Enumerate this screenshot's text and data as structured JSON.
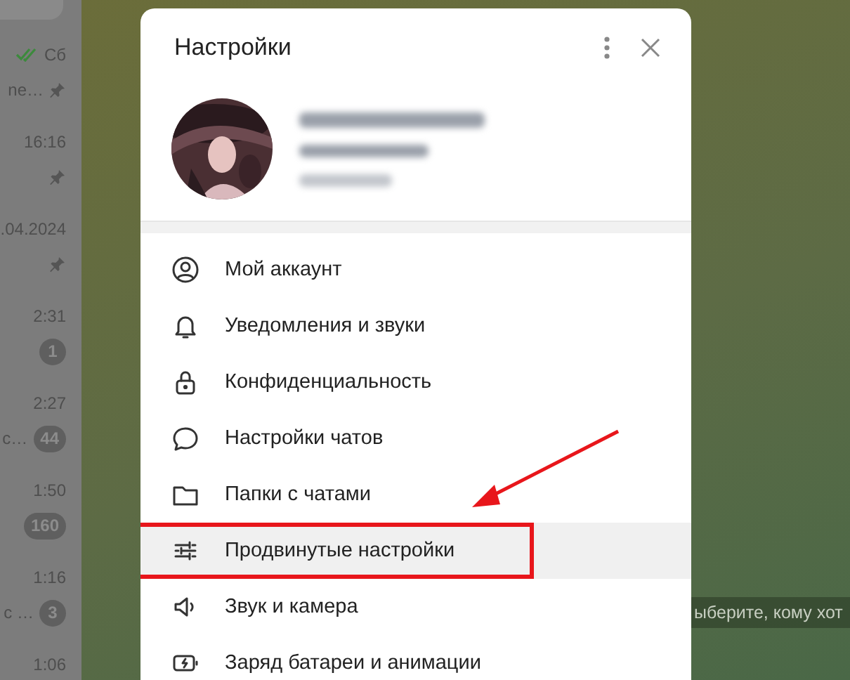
{
  "chat_list": [
    {
      "time": "Сб",
      "read": true,
      "preview": "ne…",
      "pinned": true
    },
    {
      "time": "16:16",
      "read": false,
      "pinned": true
    },
    {
      "time": ".04.2024",
      "read": false,
      "pinned": true
    },
    {
      "time": "2:31",
      "read": false,
      "pinned": false,
      "badge": "1"
    },
    {
      "time": "2:27",
      "read": false,
      "preview": "с…",
      "pinned": false,
      "badge": "44"
    },
    {
      "time": "1:50",
      "read": false,
      "pinned": false,
      "badge": "160"
    },
    {
      "time": "1:16",
      "read": false,
      "preview": "с …",
      "pinned": false,
      "badge": "3"
    },
    {
      "time": "1:06",
      "read": false,
      "pinned": false
    }
  ],
  "chat_hint": "ыберите, кому хот",
  "settings": {
    "title": "Настройки",
    "items": [
      {
        "label": "Мой аккаунт",
        "selected": false,
        "annotated": false
      },
      {
        "label": "Уведомления и звуки",
        "selected": false,
        "annotated": false
      },
      {
        "label": "Конфиденциальность",
        "selected": false,
        "annotated": false
      },
      {
        "label": "Настройки чатов",
        "selected": false,
        "annotated": false
      },
      {
        "label": "Папки с чатами",
        "selected": false,
        "annotated": false
      },
      {
        "label": "Продвинутые настройки",
        "selected": true,
        "annotated": true
      },
      {
        "label": "Звук и камера",
        "selected": false,
        "annotated": false
      },
      {
        "label": "Заряд батареи и анимации",
        "selected": false,
        "annotated": false
      }
    ]
  }
}
